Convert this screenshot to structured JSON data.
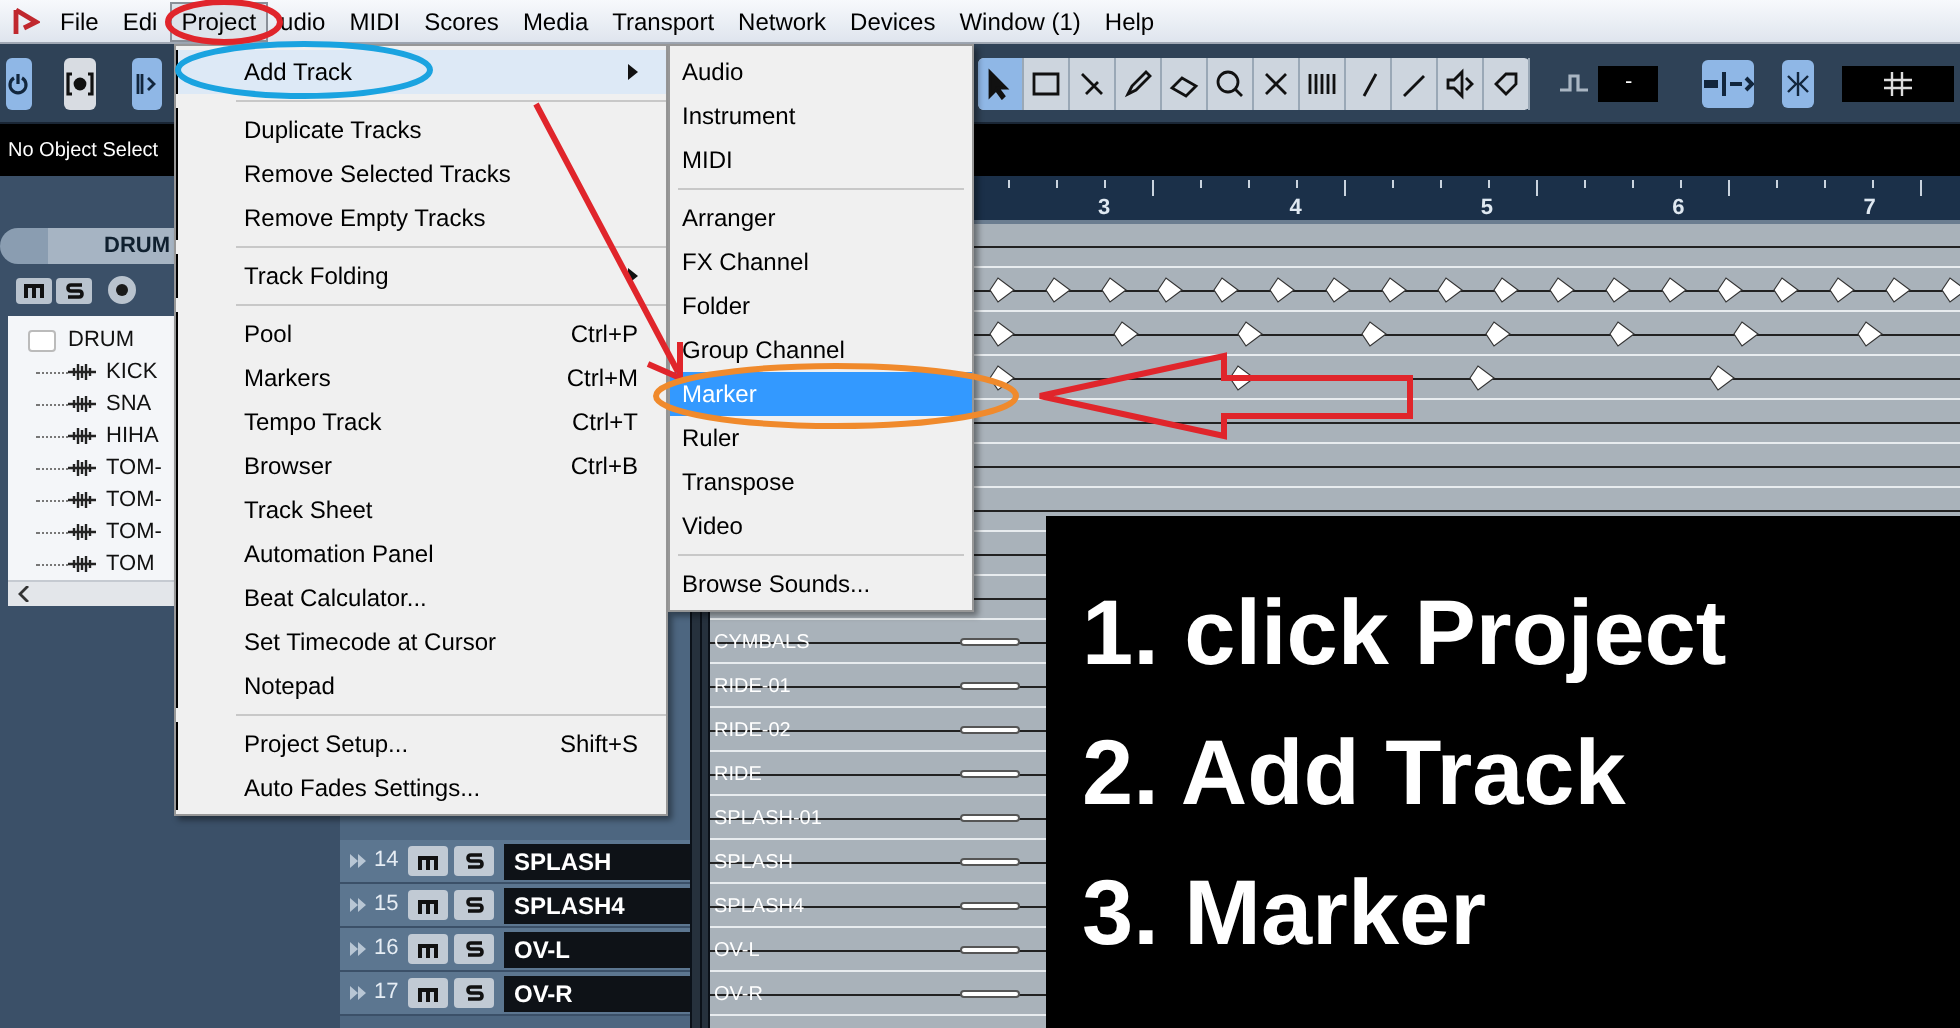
{
  "menubar": [
    {
      "label": "File",
      "selected": false
    },
    {
      "label": "Edi",
      "selected": false
    },
    {
      "label": "Project",
      "selected": true
    },
    {
      "label": "udio",
      "selected": false
    },
    {
      "label": "MIDI",
      "selected": false
    },
    {
      "label": "Scores",
      "selected": false
    },
    {
      "label": "Media",
      "selected": false
    },
    {
      "label": "Transport",
      "selected": false
    },
    {
      "label": "Network",
      "selected": false
    },
    {
      "label": "Devices",
      "selected": false
    },
    {
      "label": "Window (1)",
      "selected": false
    },
    {
      "label": "Help",
      "selected": false
    }
  ],
  "toolbar": {
    "quantize_value": "-"
  },
  "info_line": "No Object Select",
  "inspector": {
    "track_name": "DRUM",
    "folder": {
      "label": "DRUM",
      "children": [
        {
          "label": "KICK"
        },
        {
          "label": "SNA"
        },
        {
          "label": "HIHA"
        },
        {
          "label": "TOM-"
        },
        {
          "label": "TOM-"
        },
        {
          "label": "TOM-"
        },
        {
          "label": "TOM"
        }
      ]
    }
  },
  "tracks": [
    {
      "number": "14",
      "name": "SPLASH"
    },
    {
      "number": "15",
      "name": "SPLASH4"
    },
    {
      "number": "16",
      "name": "OV-L"
    },
    {
      "number": "17",
      "name": "OV-R"
    }
  ],
  "ruler": [
    "3",
    "4",
    "5",
    "6",
    "7"
  ],
  "lanes": [
    {
      "label": "CYMBALS"
    },
    {
      "label": "RIDE-01"
    },
    {
      "label": "RIDE-02"
    },
    {
      "label": "RIDE"
    },
    {
      "label": "SPLASH-01"
    },
    {
      "label": "SPLASH"
    },
    {
      "label": "SPLASH4"
    },
    {
      "label": "OV-L"
    },
    {
      "label": "OV-R"
    }
  ],
  "project_menu": [
    {
      "kind": "item",
      "label": "Add Track",
      "submenu": true,
      "selected": true
    },
    {
      "kind": "separator"
    },
    {
      "kind": "item",
      "label": "Duplicate Tracks",
      "selected": false
    },
    {
      "kind": "item",
      "label": "Remove Selected Tracks",
      "selected": false
    },
    {
      "kind": "item",
      "label": "Remove Empty Tracks",
      "selected": false
    },
    {
      "kind": "separator"
    },
    {
      "kind": "item",
      "label": "Track Folding",
      "submenu": true,
      "selected": false
    },
    {
      "kind": "separator"
    },
    {
      "kind": "item",
      "label": "Pool",
      "shortcut": "Ctrl+P",
      "selected": false
    },
    {
      "kind": "item",
      "label": "Markers",
      "shortcut": "Ctrl+M",
      "selected": false
    },
    {
      "kind": "item",
      "label": "Tempo Track",
      "shortcut": "Ctrl+T",
      "selected": false
    },
    {
      "kind": "item",
      "label": "Browser",
      "shortcut": "Ctrl+B",
      "selected": false
    },
    {
      "kind": "item",
      "label": "Track Sheet",
      "selected": false
    },
    {
      "kind": "item",
      "label": "Automation Panel",
      "selected": false
    },
    {
      "kind": "item",
      "label": "Beat Calculator...",
      "selected": false
    },
    {
      "kind": "item",
      "label": "Set Timecode at Cursor",
      "selected": false
    },
    {
      "kind": "item",
      "label": "Notepad",
      "selected": false
    },
    {
      "kind": "separator"
    },
    {
      "kind": "item",
      "label": "Project Setup...",
      "shortcut": "Shift+S",
      "selected": false
    },
    {
      "kind": "item",
      "label": "Auto Fades Settings...",
      "selected": false
    }
  ],
  "add_track_submenu": [
    {
      "kind": "item",
      "label": "Audio",
      "selected": false
    },
    {
      "kind": "item",
      "label": "Instrument",
      "selected": false
    },
    {
      "kind": "item",
      "label": "MIDI",
      "selected": false
    },
    {
      "kind": "separator"
    },
    {
      "kind": "item",
      "label": "Arranger",
      "selected": false
    },
    {
      "kind": "item",
      "label": "FX Channel",
      "selected": false
    },
    {
      "kind": "item",
      "label": "Folder",
      "selected": false
    },
    {
      "kind": "item",
      "label": "Group Channel",
      "selected": false
    },
    {
      "kind": "item",
      "label": "Marker",
      "selected": true
    },
    {
      "kind": "item",
      "label": "Ruler",
      "selected": false
    },
    {
      "kind": "item",
      "label": "Transpose",
      "selected": false
    },
    {
      "kind": "item",
      "label": "Video",
      "selected": false
    },
    {
      "kind": "separator"
    },
    {
      "kind": "item",
      "label": "Browse Sounds...",
      "selected": false
    }
  ],
  "instructions": [
    {
      "text": "1. click Project"
    },
    {
      "text": "2. Add Track"
    },
    {
      "text": "3. Marker"
    }
  ]
}
